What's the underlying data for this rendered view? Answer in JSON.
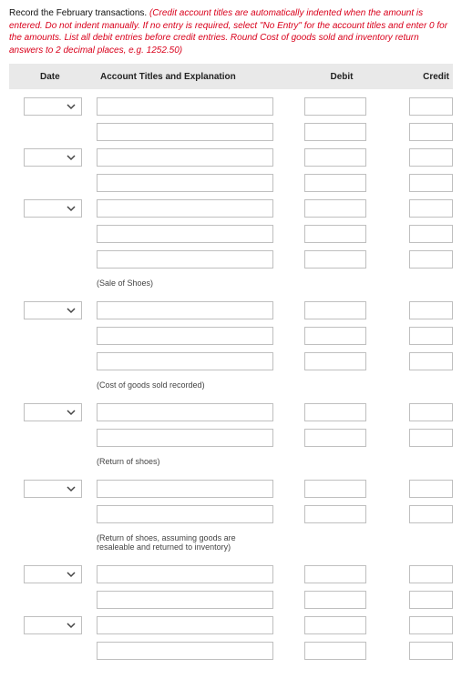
{
  "instructions": {
    "lead": "Record the February transactions.",
    "warn": "(Credit account titles are automatically indented when the amount is entered. Do not indent manually. If no entry is required, select \"No Entry\" for the account titles and enter 0 for the amounts. List all debit entries before credit entries. Round Cost of goods sold and inventory return answers to 2 decimal places, e.g. 1252.50)"
  },
  "headers": {
    "date": "Date",
    "account": "Account Titles and Explanation",
    "debit": "Debit",
    "credit": "Credit"
  },
  "groups": [
    {
      "rows": [
        {
          "showDate": true,
          "showDebit": true,
          "showCredit": true
        },
        {
          "showDate": false,
          "showDebit": true,
          "showCredit": true
        }
      ],
      "note": ""
    },
    {
      "rows": [
        {
          "showDate": true,
          "showDebit": true,
          "showCredit": true
        },
        {
          "showDate": false,
          "showDebit": true,
          "showCredit": true
        }
      ],
      "note": ""
    },
    {
      "rows": [
        {
          "showDate": true,
          "showDebit": true,
          "showCredit": true
        },
        {
          "showDate": false,
          "showDebit": true,
          "showCredit": true
        },
        {
          "showDate": false,
          "showDebit": true,
          "showCredit": true
        }
      ],
      "note": "(Sale of Shoes)"
    },
    {
      "rows": [
        {
          "showDate": true,
          "showDebit": true,
          "showCredit": true
        },
        {
          "showDate": false,
          "showDebit": true,
          "showCredit": true
        },
        {
          "showDate": false,
          "showDebit": true,
          "showCredit": true
        }
      ],
      "note": "(Cost of goods sold recorded)"
    },
    {
      "rows": [
        {
          "showDate": true,
          "showDebit": true,
          "showCredit": true
        },
        {
          "showDate": false,
          "showDebit": true,
          "showCredit": true
        }
      ],
      "note": "(Return of shoes)"
    },
    {
      "rows": [
        {
          "showDate": true,
          "showDebit": true,
          "showCredit": true
        },
        {
          "showDate": false,
          "showDebit": true,
          "showCredit": true
        }
      ],
      "note": "(Return of shoes, assuming goods are resaleable and returned to inventory)"
    },
    {
      "rows": [
        {
          "showDate": true,
          "showDebit": true,
          "showCredit": true
        },
        {
          "showDate": false,
          "showDebit": true,
          "showCredit": true
        }
      ],
      "note": ""
    },
    {
      "rows": [
        {
          "showDate": true,
          "showDebit": true,
          "showCredit": true
        },
        {
          "showDate": false,
          "showDebit": true,
          "showCredit": true
        }
      ],
      "note": ""
    }
  ]
}
